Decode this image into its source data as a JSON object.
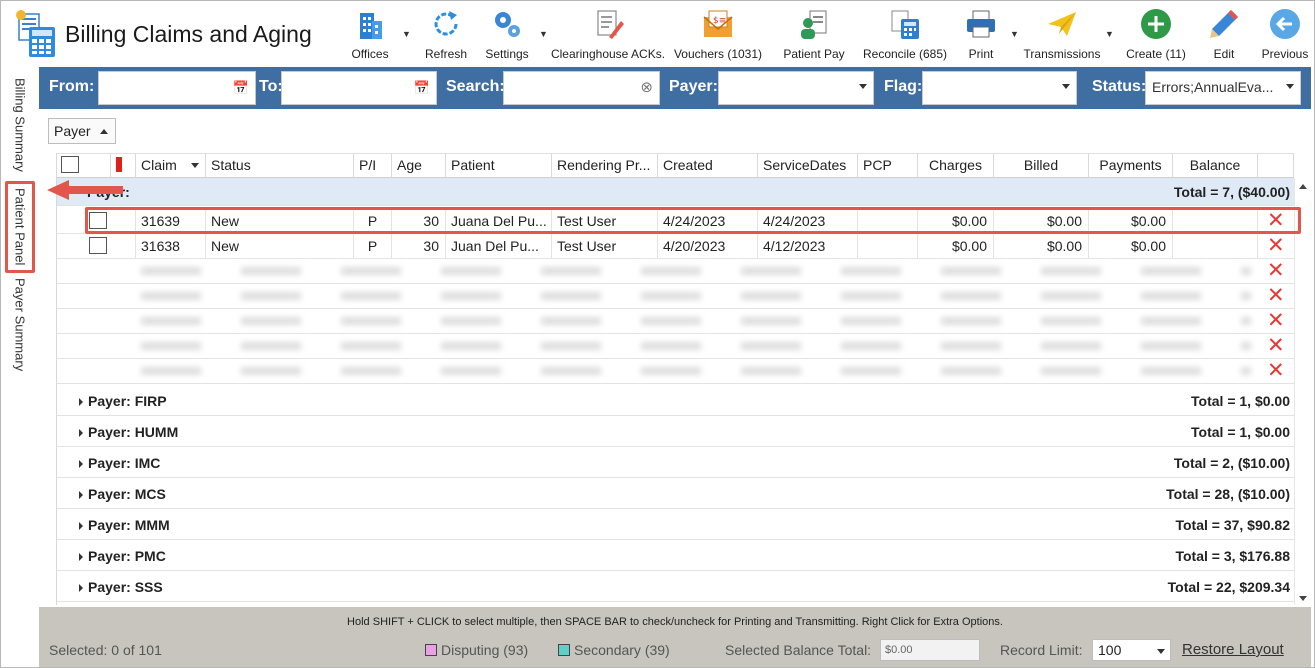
{
  "app": {
    "title": "Billing Claims and Aging"
  },
  "toolbar": {
    "offices": "Offices",
    "refresh": "Refresh",
    "settings": "Settings",
    "clearinghouse": "Clearinghouse ACKs.",
    "vouchers": "Vouchers (1031)",
    "patient_pay": "Patient Pay",
    "reconcile": "Reconcile (685)",
    "print": "Print",
    "transmissions": "Transmissions",
    "create": "Create (11)",
    "edit": "Edit",
    "previous": "Previous"
  },
  "side_tabs": {
    "billing_summary": "Billing Summary",
    "patient_panel": "Patient Panel",
    "payer_summary": "Payer Summary"
  },
  "filters": {
    "from_label": "From:",
    "to_label": "To:",
    "search_label": "Search:",
    "payer_label": "Payer:",
    "flag_label": "Flag:",
    "status_label": "Status:",
    "from_value": "",
    "to_value": "",
    "search_value": "",
    "payer_value": "",
    "flag_value": "",
    "status_value": "Errors;AnnualEva..."
  },
  "group_by": {
    "label": "Payer"
  },
  "columns": {
    "claim": "Claim",
    "status": "Status",
    "pi": "P/I",
    "age": "Age",
    "patient": "Patient",
    "rendering": "Rendering Pr...",
    "created": "Created",
    "service_dates": "ServiceDates",
    "pcp": "PCP",
    "charges": "Charges",
    "billed": "Billed",
    "payments": "Payments",
    "balance": "Balance"
  },
  "expanded_group": {
    "label": "Payer:",
    "total": "Total = 7,  ($40.00)"
  },
  "rows": [
    {
      "claim": "31639",
      "status": "New",
      "pi": "P",
      "age": "30",
      "patient": "Juana Del Pu...",
      "rendering": "Test User",
      "created": "4/24/2023",
      "service_dates": "4/24/2023",
      "pcp": "",
      "charges": "$0.00",
      "billed": "$0.00",
      "payments": "$0.00",
      "balance": ""
    },
    {
      "claim": "31638",
      "status": "New",
      "pi": "P",
      "age": "30",
      "patient": "Juan  Del Pu...",
      "rendering": "Test User",
      "created": "4/20/2023",
      "service_dates": "4/12/2023",
      "pcp": "",
      "charges": "$0.00",
      "billed": "$0.00",
      "payments": "$0.00",
      "balance": ""
    }
  ],
  "groups": [
    {
      "label": "Payer: FIRP",
      "total": "Total = 1,  $0.00"
    },
    {
      "label": "Payer: HUMM",
      "total": "Total = 1,  $0.00"
    },
    {
      "label": "Payer: IMC",
      "total": "Total = 2,  ($10.00)"
    },
    {
      "label": "Payer: MCS",
      "total": "Total = 28,  ($10.00)"
    },
    {
      "label": "Payer: MMM",
      "total": "Total = 37,  $90.82"
    },
    {
      "label": "Payer: PMC",
      "total": "Total = 3,  $176.88"
    },
    {
      "label": "Payer: SSS",
      "total": "Total = 22,  $209.34"
    }
  ],
  "footer": {
    "hint": "Hold SHIFT + CLICK to select multiple, then SPACE BAR to check/uncheck for Printing and Transmitting. Right Click for Extra Options.",
    "selected": "Selected: 0 of 101",
    "disputing": "Disputing (93)",
    "secondary": "Secondary (39)",
    "selected_balance_label": "Selected Balance Total:",
    "selected_balance_value": "$0.00",
    "record_limit_label": "Record Limit:",
    "record_limit_value": "100",
    "restore_layout": "Restore Layout"
  },
  "colors": {
    "filter_bar": "#3f6ea3",
    "highlight": "#e2574c",
    "disputing": "#e9a0e6",
    "secondary": "#5fd0c8",
    "delete_x": "#e53935"
  }
}
